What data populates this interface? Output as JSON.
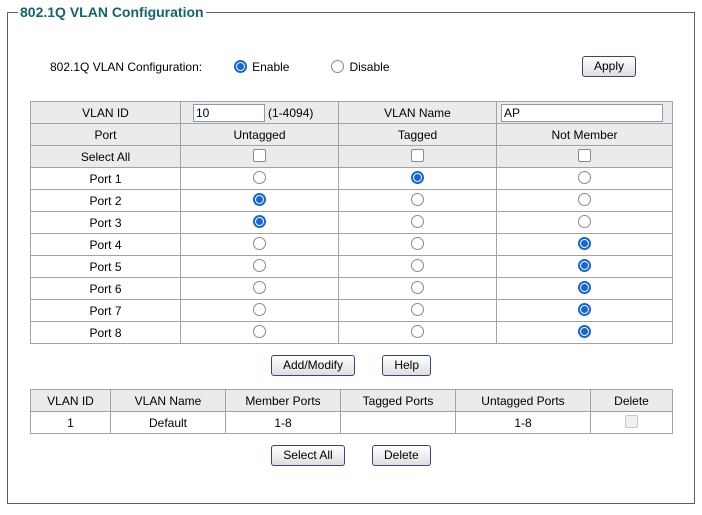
{
  "frame": {
    "legend": "802.1Q VLAN Configuration"
  },
  "config_row": {
    "label": "802.1Q VLAN Configuration:",
    "enable_label": "Enable",
    "disable_label": "Disable",
    "selected_option": "Enable",
    "apply_label": "Apply"
  },
  "vlan_form": {
    "vlan_id_label": "VLAN ID",
    "vlan_id_value": "10",
    "vlan_id_hint": "(1-4094)",
    "vlan_name_label": "VLAN Name",
    "vlan_name_value": "AP",
    "columns": {
      "port": "Port",
      "untagged": "Untagged",
      "tagged": "Tagged",
      "not_member": "Not Member"
    },
    "select_all_label": "Select All",
    "select_all_checks": {
      "untagged": false,
      "tagged": false,
      "not_member": false
    },
    "ports": [
      {
        "name": "Port 1",
        "membership": "tagged"
      },
      {
        "name": "Port 2",
        "membership": "untagged"
      },
      {
        "name": "Port 3",
        "membership": "untagged"
      },
      {
        "name": "Port 4",
        "membership": "not_member"
      },
      {
        "name": "Port 5",
        "membership": "not_member"
      },
      {
        "name": "Port 6",
        "membership": "not_member"
      },
      {
        "name": "Port 7",
        "membership": "not_member"
      },
      {
        "name": "Port 8",
        "membership": "not_member"
      }
    ],
    "add_modify_label": "Add/Modify",
    "help_label": "Help"
  },
  "vlan_table": {
    "headers": [
      "VLAN ID",
      "VLAN Name",
      "Member Ports",
      "Tagged Ports",
      "Untagged Ports",
      "Delete"
    ],
    "rows": [
      {
        "vlan_id": "1",
        "vlan_name": "Default",
        "member_ports": "1-8",
        "tagged_ports": "",
        "untagged_ports": "1-8",
        "delete_checked": false,
        "delete_disabled": true
      }
    ],
    "select_all_label": "Select All",
    "delete_label": "Delete"
  },
  "colors": {
    "legend_text": "#136470",
    "radio_selected": "#1766d1",
    "table_border": "#a3a3a3",
    "header_row_bg": "#ebebeb",
    "button_border": "#30497b",
    "input_border": "#7f9db9"
  }
}
